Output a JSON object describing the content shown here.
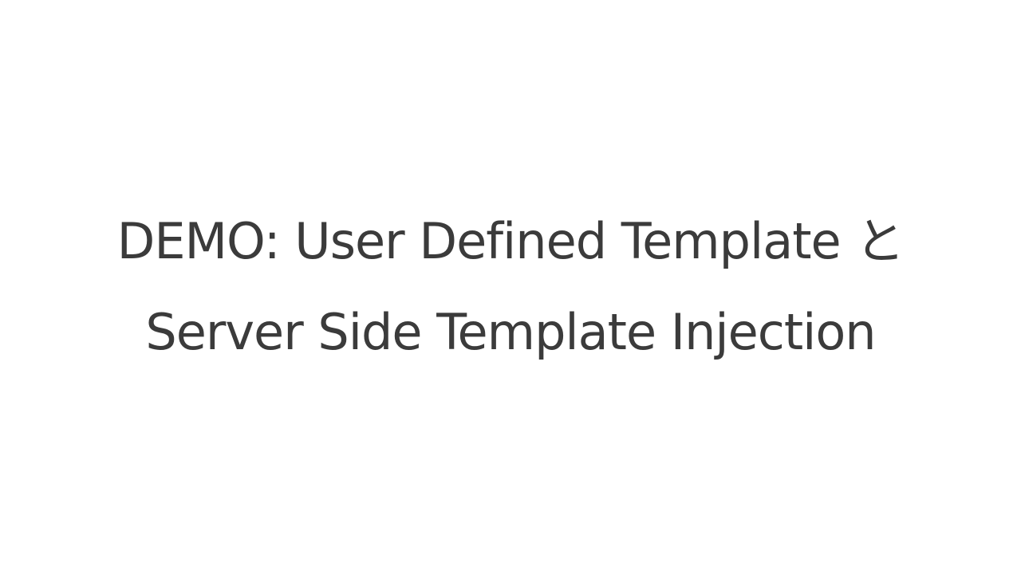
{
  "slide": {
    "title_line_1": "DEMO: User Defined Template と",
    "title_line_2": "Server Side Template Injection"
  },
  "colors": {
    "background": "#ffffff",
    "text": "#3b3b3b"
  }
}
